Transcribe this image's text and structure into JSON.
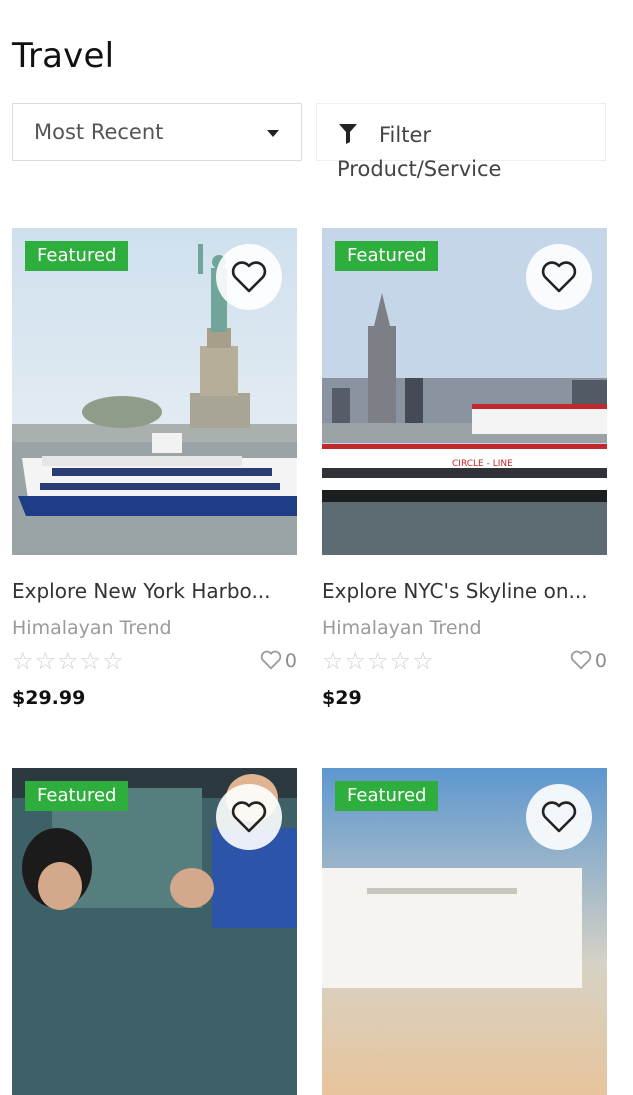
{
  "page": {
    "title": "Travel"
  },
  "controls": {
    "sort_label": "Most Recent",
    "filter_label": "Filter Product/Service"
  },
  "cards": [
    {
      "badge": "Featured",
      "title": "Explore New York Harbo...",
      "seller": "Himalayan Trend",
      "rating": 0,
      "stars": "☆☆☆☆☆",
      "likes": "0",
      "price": "$29.99"
    },
    {
      "badge": "Featured",
      "title": "Explore NYC's Skyline on...",
      "seller": "Himalayan Trend",
      "rating": 0,
      "stars": "☆☆☆☆☆",
      "likes": "0",
      "price": "$29"
    },
    {
      "badge": "Featured"
    },
    {
      "badge": "Featured"
    }
  ],
  "colors": {
    "badge": "#2eae3c",
    "accent_star": "#cfcfcf"
  },
  "icons": {
    "favorite": "heart-icon",
    "filter": "filter-icon",
    "sort": "chevron-down-icon"
  }
}
